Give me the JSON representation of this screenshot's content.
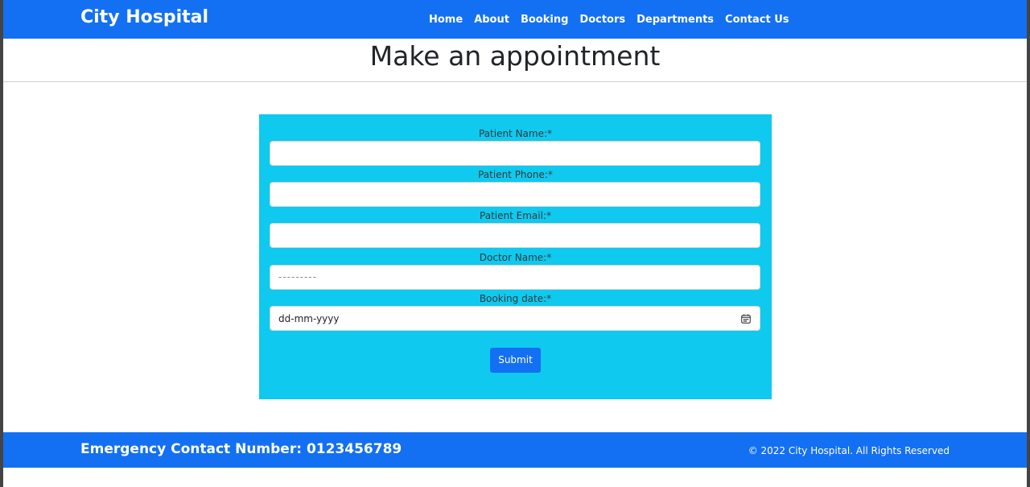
{
  "navbar": {
    "brand": "City Hospital",
    "links": [
      "Home",
      "About",
      "Booking",
      "Doctors",
      "Departments",
      "Contact Us"
    ]
  },
  "main": {
    "title": "Make an appointment"
  },
  "form": {
    "patient_name_label": "Patient Name:*",
    "patient_name_value": "",
    "patient_phone_label": "Patient Phone:*",
    "patient_phone_value": "",
    "patient_email_label": "Patient Email:*",
    "patient_email_value": "",
    "doctor_name_label": "Doctor Name:*",
    "doctor_name_selected": "---------",
    "booking_date_label": "Booking date:*",
    "booking_date_placeholder": "dd-mm-yyyy",
    "submit_label": "Submit"
  },
  "footer": {
    "emergency": "Emergency Contact Number: 0123456789",
    "copyright": "© 2022 City Hospital. All Rights Reserved"
  },
  "colors": {
    "primary": "#1370f2",
    "form_panel": "#0fc9ee",
    "page_background": "#ffffff"
  },
  "icons": {
    "date_picker": "calendar-icon"
  }
}
